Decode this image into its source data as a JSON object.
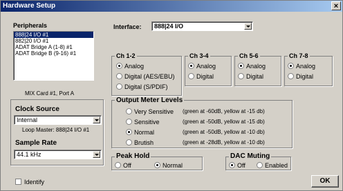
{
  "window": {
    "title": "Hardware Setup",
    "close_glyph": "×"
  },
  "peripherals": {
    "label": "Peripherals",
    "items": [
      "888|24 I/O #1",
      "882|20 I/O #1",
      "ADAT Bridge A (1-8) #1",
      "ADAT Bridge B (9-16) #1"
    ],
    "selected_index": 0
  },
  "mix_card_label": "MIX Card #1, Port A",
  "clock_source": {
    "label": "Clock Source",
    "value": "Internal",
    "loop_master": "Loop Master: 888|24 I/O #1"
  },
  "sample_rate": {
    "label": "Sample Rate",
    "value": "44.1 kHz"
  },
  "interface": {
    "label": "Interface:",
    "value": "888|24 I/O"
  },
  "channels": {
    "ch12": {
      "label": "Ch 1-2",
      "options": [
        "Analog",
        "Digital (AES/EBU)",
        "Digital (S/PDIF)"
      ],
      "selected": 0
    },
    "ch34": {
      "label": "Ch 3-4",
      "options": [
        "Analog",
        "Digital"
      ],
      "selected": 0
    },
    "ch56": {
      "label": "Ch 5-6",
      "options": [
        "Analog",
        "Digital"
      ],
      "selected": 0
    },
    "ch78": {
      "label": "Ch 7-8",
      "options": [
        "Analog",
        "Digital"
      ],
      "selected": 0
    }
  },
  "output_meter": {
    "label": "Output Meter Levels",
    "options": [
      {
        "name": "Very Sensitive",
        "desc": "(green at -60dB, yellow at -15 db)"
      },
      {
        "name": "Sensitive",
        "desc": "(green at -50dB, yellow at -15 db)"
      },
      {
        "name": "Normal",
        "desc": "(green at -50dB, yellow at -10 db)"
      },
      {
        "name": "Brutish",
        "desc": "(green at -28dB, yellow at -10 db)"
      }
    ],
    "selected": 2
  },
  "peak_hold": {
    "label": "Peak Hold",
    "options": [
      "Off",
      "Normal"
    ],
    "selected": 1
  },
  "dac_muting": {
    "label": "DAC Muting",
    "options": [
      "Off",
      "Enabled"
    ],
    "selected": 0
  },
  "identify_label": "Identify",
  "ok_label": "OK"
}
